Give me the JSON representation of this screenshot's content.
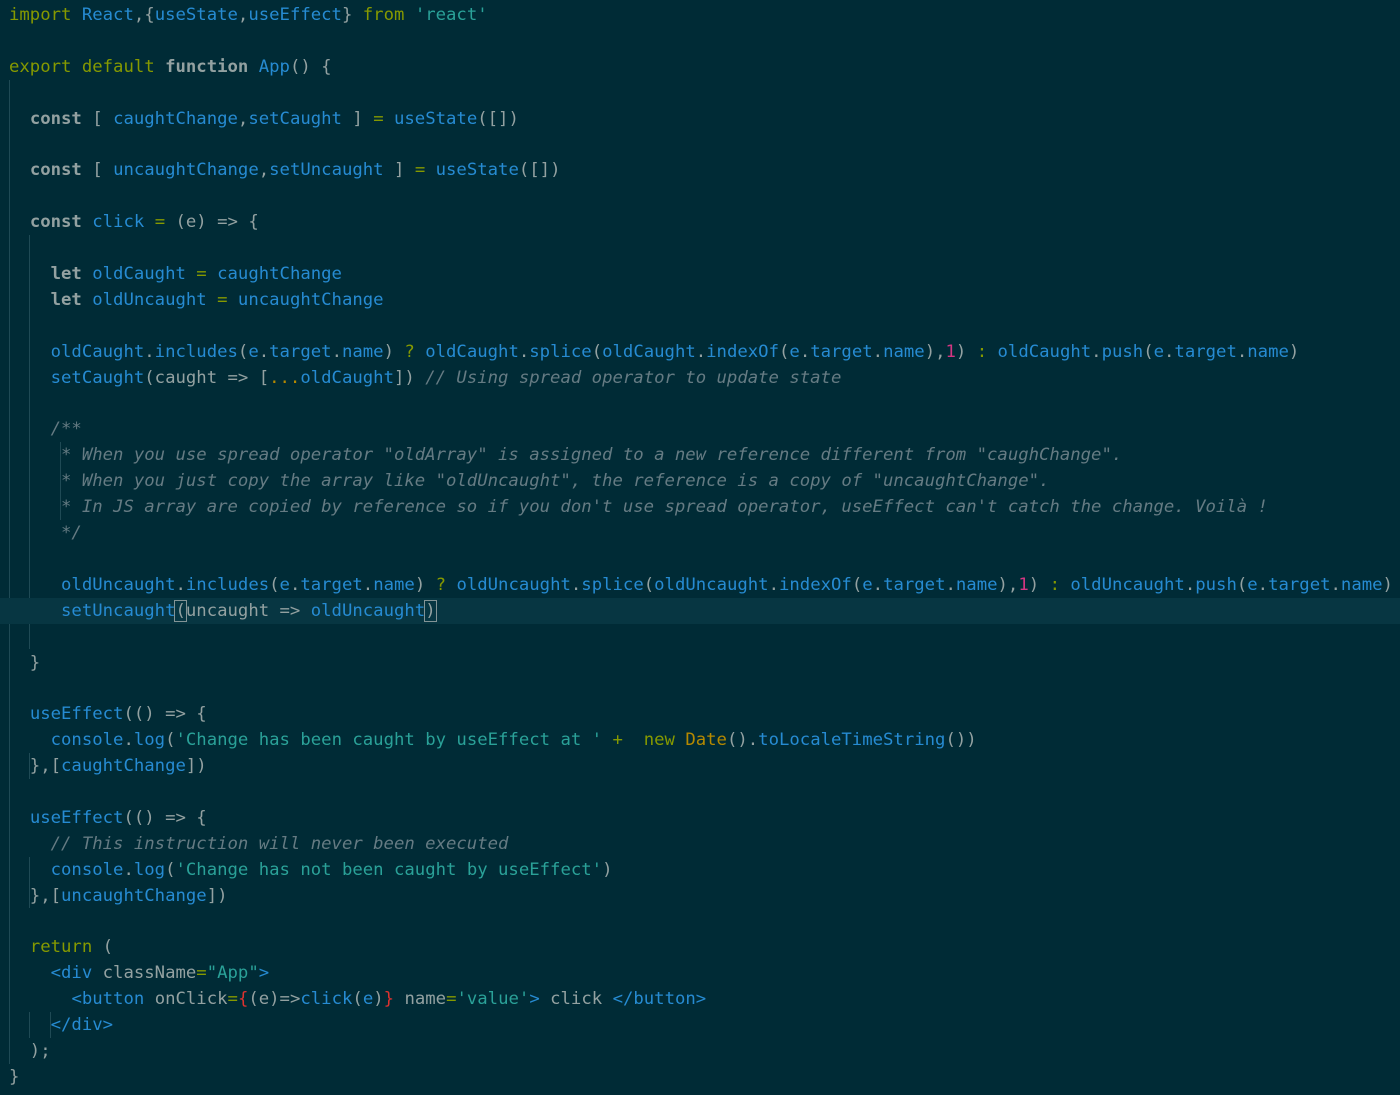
{
  "editor": {
    "theme": "solarized-dark",
    "colors": {
      "background": "#002b36",
      "current_line": "#073642",
      "keyword": "#859900",
      "function": "#268bd2",
      "string": "#2aa198",
      "number": "#d33682",
      "comment": "#657b83",
      "class": "#b58900",
      "text": "#93a1a1"
    },
    "lines": [
      [
        [
          "kw-imp",
          "import"
        ],
        [
          "pl",
          " "
        ],
        [
          "id",
          "React"
        ],
        [
          "pl",
          ",{"
        ],
        [
          "id",
          "useState"
        ],
        [
          "pl",
          ","
        ],
        [
          "id",
          "useEffect"
        ],
        [
          "pl",
          "} "
        ],
        [
          "kw-imp",
          "from"
        ],
        [
          "pl",
          " "
        ],
        [
          "str",
          "'react'"
        ]
      ],
      [],
      [
        [
          "kw",
          "export"
        ],
        [
          "pl",
          " "
        ],
        [
          "kw",
          "default"
        ],
        [
          "pl",
          " "
        ],
        [
          "kw-b",
          "function"
        ],
        [
          "pl",
          " "
        ],
        [
          "fn",
          "App"
        ],
        [
          "pl",
          "() {"
        ]
      ],
      [],
      [
        [
          "pl",
          "  "
        ],
        [
          "kw-b",
          "const"
        ],
        [
          "pl",
          " [ "
        ],
        [
          "id",
          "caughtChange"
        ],
        [
          "pl",
          ","
        ],
        [
          "id",
          "setCaught"
        ],
        [
          "pl",
          " ] "
        ],
        [
          "op",
          "="
        ],
        [
          "pl",
          " "
        ],
        [
          "fn",
          "useState"
        ],
        [
          "pl",
          "([])"
        ]
      ],
      [],
      [
        [
          "pl",
          "  "
        ],
        [
          "kw-b",
          "const"
        ],
        [
          "pl",
          " [ "
        ],
        [
          "id",
          "uncaughtChange"
        ],
        [
          "pl",
          ","
        ],
        [
          "id",
          "setUncaught"
        ],
        [
          "pl",
          " ] "
        ],
        [
          "op",
          "="
        ],
        [
          "pl",
          " "
        ],
        [
          "fn",
          "useState"
        ],
        [
          "pl",
          "([])"
        ]
      ],
      [],
      [
        [
          "pl",
          "  "
        ],
        [
          "kw-b",
          "const"
        ],
        [
          "pl",
          " "
        ],
        [
          "id",
          "click"
        ],
        [
          "pl",
          " "
        ],
        [
          "op",
          "="
        ],
        [
          "pl",
          " (e) => {"
        ]
      ],
      [],
      [
        [
          "pl",
          "    "
        ],
        [
          "kw-b",
          "let"
        ],
        [
          "pl",
          " "
        ],
        [
          "id",
          "oldCaught"
        ],
        [
          "pl",
          " "
        ],
        [
          "op",
          "="
        ],
        [
          "pl",
          " "
        ],
        [
          "id",
          "caughtChange"
        ]
      ],
      [
        [
          "pl",
          "    "
        ],
        [
          "kw-b",
          "let"
        ],
        [
          "pl",
          " "
        ],
        [
          "id",
          "oldUncaught"
        ],
        [
          "pl",
          " "
        ],
        [
          "op",
          "="
        ],
        [
          "pl",
          " "
        ],
        [
          "id",
          "uncaughtChange"
        ]
      ],
      [],
      [
        [
          "pl",
          "    "
        ],
        [
          "id",
          "oldCaught"
        ],
        [
          "pl",
          "."
        ],
        [
          "fn",
          "includes"
        ],
        [
          "pl",
          "("
        ],
        [
          "id",
          "e"
        ],
        [
          "pl",
          "."
        ],
        [
          "id",
          "target"
        ],
        [
          "pl",
          "."
        ],
        [
          "id",
          "name"
        ],
        [
          "pl",
          ") "
        ],
        [
          "op",
          "?"
        ],
        [
          "pl",
          " "
        ],
        [
          "id",
          "oldCaught"
        ],
        [
          "pl",
          "."
        ],
        [
          "fn",
          "splice"
        ],
        [
          "pl",
          "("
        ],
        [
          "id",
          "oldCaught"
        ],
        [
          "pl",
          "."
        ],
        [
          "fn",
          "indexOf"
        ],
        [
          "pl",
          "("
        ],
        [
          "id",
          "e"
        ],
        [
          "pl",
          "."
        ],
        [
          "id",
          "target"
        ],
        [
          "pl",
          "."
        ],
        [
          "id",
          "name"
        ],
        [
          "pl",
          "),"
        ],
        [
          "num",
          "1"
        ],
        [
          "pl",
          ") "
        ],
        [
          "op",
          ":"
        ],
        [
          "pl",
          " "
        ],
        [
          "id",
          "oldCaught"
        ],
        [
          "pl",
          "."
        ],
        [
          "fn",
          "push"
        ],
        [
          "pl",
          "("
        ],
        [
          "id",
          "e"
        ],
        [
          "pl",
          "."
        ],
        [
          "id",
          "target"
        ],
        [
          "pl",
          "."
        ],
        [
          "id",
          "name"
        ],
        [
          "pl",
          ")"
        ]
      ],
      [
        [
          "pl",
          "    "
        ],
        [
          "fn",
          "setCaught"
        ],
        [
          "pl",
          "(caught => ["
        ],
        [
          "yl",
          "..."
        ],
        [
          "id",
          "oldCaught"
        ],
        [
          "pl",
          "]) "
        ],
        [
          "cm",
          "// Using spread operator to update state"
        ]
      ],
      [],
      [
        [
          "pl",
          "    "
        ],
        [
          "cm",
          "/**"
        ]
      ],
      [
        [
          "pl",
          "     "
        ],
        [
          "cm",
          "* When you use spread operator \"oldArray\" is assigned to a new reference different from \"caughChange\"."
        ]
      ],
      [
        [
          "pl",
          "     "
        ],
        [
          "cm",
          "* When you just copy the array like \"oldUncaught\", the reference is a copy of \"uncaughtChange\"."
        ]
      ],
      [
        [
          "pl",
          "     "
        ],
        [
          "cm",
          "* In JS array are copied by reference so if you don't use spread operator, useEffect can't catch the change. Voilà !"
        ]
      ],
      [
        [
          "pl",
          "     "
        ],
        [
          "cm",
          "*/"
        ]
      ],
      [],
      [
        [
          "pl",
          "     "
        ],
        [
          "id",
          "oldUncaught"
        ],
        [
          "pl",
          "."
        ],
        [
          "fn",
          "includes"
        ],
        [
          "pl",
          "("
        ],
        [
          "id",
          "e"
        ],
        [
          "pl",
          "."
        ],
        [
          "id",
          "target"
        ],
        [
          "pl",
          "."
        ],
        [
          "id",
          "name"
        ],
        [
          "pl",
          ") "
        ],
        [
          "op",
          "?"
        ],
        [
          "pl",
          " "
        ],
        [
          "id",
          "oldUncaught"
        ],
        [
          "pl",
          "."
        ],
        [
          "fn",
          "splice"
        ],
        [
          "pl",
          "("
        ],
        [
          "id",
          "oldUncaught"
        ],
        [
          "pl",
          "."
        ],
        [
          "fn",
          "indexOf"
        ],
        [
          "pl",
          "("
        ],
        [
          "id",
          "e"
        ],
        [
          "pl",
          "."
        ],
        [
          "id",
          "target"
        ],
        [
          "pl",
          "."
        ],
        [
          "id",
          "name"
        ],
        [
          "pl",
          "),"
        ],
        [
          "num",
          "1"
        ],
        [
          "pl",
          ") "
        ],
        [
          "op",
          ":"
        ],
        [
          "pl",
          " "
        ],
        [
          "id",
          "oldUncaught"
        ],
        [
          "pl",
          "."
        ],
        [
          "fn",
          "push"
        ],
        [
          "pl",
          "("
        ],
        [
          "id",
          "e"
        ],
        [
          "pl",
          "."
        ],
        [
          "id",
          "target"
        ],
        [
          "pl",
          "."
        ],
        [
          "id",
          "name"
        ],
        [
          "pl",
          ")"
        ]
      ],
      [
        [
          "pl",
          "     "
        ],
        [
          "fn",
          "setUncaught"
        ],
        [
          "brk",
          "("
        ],
        [
          "pl",
          "uncaught => "
        ],
        [
          "id",
          "oldUncaught"
        ],
        [
          "brk",
          ")"
        ]
      ],
      [],
      [
        [
          "pl",
          "  }"
        ]
      ],
      [],
      [
        [
          "pl",
          "  "
        ],
        [
          "fn",
          "useEffect"
        ],
        [
          "pl",
          "(() => {"
        ]
      ],
      [
        [
          "pl",
          "    "
        ],
        [
          "id",
          "console"
        ],
        [
          "pl",
          "."
        ],
        [
          "fn",
          "log"
        ],
        [
          "pl",
          "("
        ],
        [
          "str",
          "'Change has been caught by useEffect at '"
        ],
        [
          "pl",
          " "
        ],
        [
          "op",
          "+"
        ],
        [
          "pl",
          "  "
        ],
        [
          "kw",
          "new"
        ],
        [
          "pl",
          " "
        ],
        [
          "cls",
          "Date"
        ],
        [
          "pl",
          "()."
        ],
        [
          "fn",
          "toLocaleTimeString"
        ],
        [
          "pl",
          "())"
        ]
      ],
      [
        [
          "pl",
          "  },["
        ],
        [
          "id",
          "caughtChange"
        ],
        [
          "pl",
          "])"
        ]
      ],
      [],
      [
        [
          "pl",
          "  "
        ],
        [
          "fn",
          "useEffect"
        ],
        [
          "pl",
          "(() => {"
        ]
      ],
      [
        [
          "pl",
          "    "
        ],
        [
          "cm",
          "// This instruction will never been executed"
        ]
      ],
      [
        [
          "pl",
          "    "
        ],
        [
          "id",
          "console"
        ],
        [
          "pl",
          "."
        ],
        [
          "fn",
          "log"
        ],
        [
          "pl",
          "("
        ],
        [
          "str",
          "'Change has not been caught by useEffect'"
        ],
        [
          "pl",
          ")"
        ]
      ],
      [
        [
          "pl",
          "  },["
        ],
        [
          "id",
          "uncaughtChange"
        ],
        [
          "pl",
          "])"
        ]
      ],
      [],
      [
        [
          "pl",
          "  "
        ],
        [
          "kw",
          "return"
        ],
        [
          "pl",
          " ("
        ]
      ],
      [
        [
          "pl",
          "    "
        ],
        [
          "tag",
          "<div"
        ],
        [
          "pl",
          " "
        ],
        [
          "attr",
          "className"
        ],
        [
          "op",
          "="
        ],
        [
          "str",
          "\"App\""
        ],
        [
          "tag",
          ">"
        ]
      ],
      [
        [
          "pl",
          "      "
        ],
        [
          "tag",
          "<button"
        ],
        [
          "pl",
          " "
        ],
        [
          "attr",
          "onClick"
        ],
        [
          "op",
          "="
        ],
        [
          "red",
          "{"
        ],
        [
          "pl",
          "(e)=>"
        ],
        [
          "fn",
          "click"
        ],
        [
          "pl",
          "("
        ],
        [
          "id",
          "e"
        ],
        [
          "pl",
          ")"
        ],
        [
          "red",
          "}"
        ],
        [
          "pl",
          " "
        ],
        [
          "attr",
          "name"
        ],
        [
          "op",
          "="
        ],
        [
          "str",
          "'value'"
        ],
        [
          "tag",
          ">"
        ],
        [
          "pl",
          " click "
        ],
        [
          "tag",
          "</button"
        ],
        [
          "tag",
          ">"
        ]
      ],
      [
        [
          "pl",
          "    "
        ],
        [
          "tag",
          "</div>"
        ]
      ],
      [
        [
          "pl",
          "  );"
        ]
      ],
      [
        [
          "pl",
          "}"
        ]
      ]
    ],
    "current_line_index": 23
  }
}
